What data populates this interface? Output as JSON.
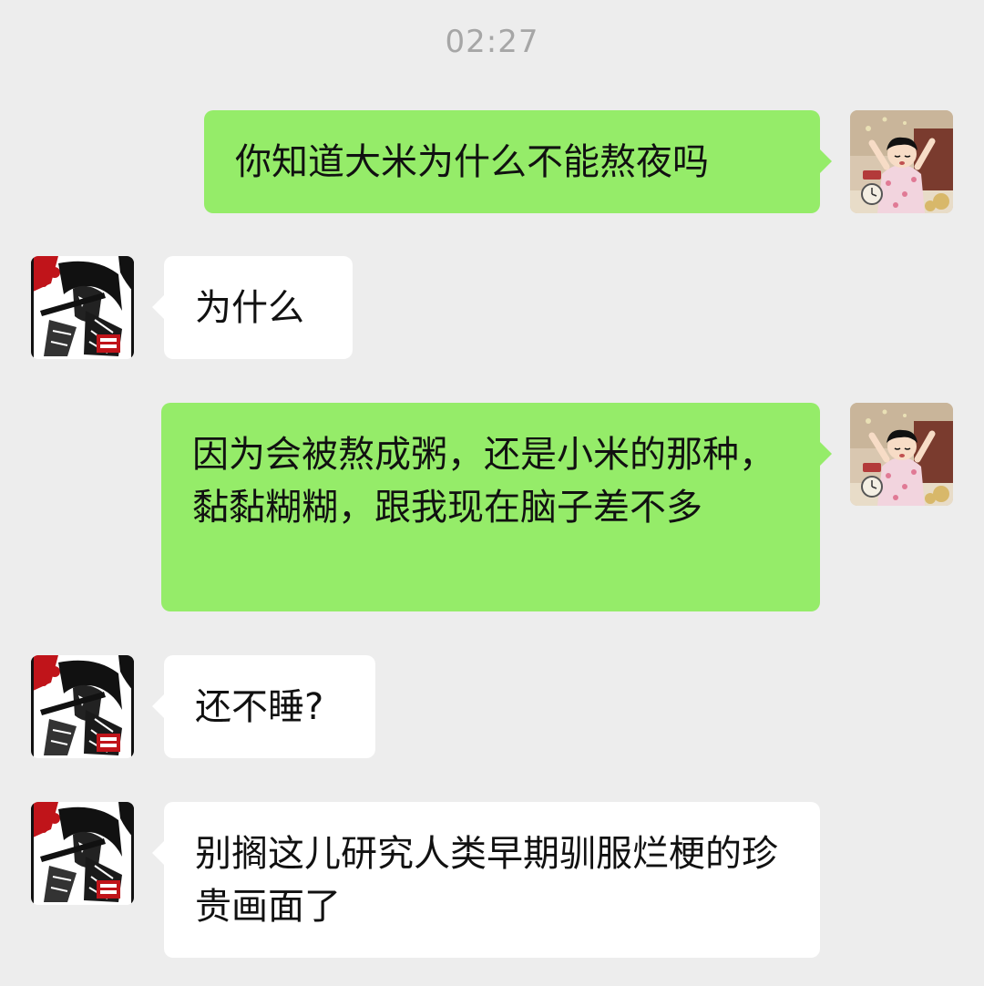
{
  "chat": {
    "timestamp": "02:27",
    "messages": [
      {
        "sender": "me",
        "text": "你知道大米为什么不能熬夜吗"
      },
      {
        "sender": "friend",
        "text": "为什么"
      },
      {
        "sender": "me",
        "text": "因为会被熬成粥，还是小米的那种，黏黏糊糊，跟我现在脑子差不多"
      },
      {
        "sender": "friend",
        "text": "还不睡?"
      },
      {
        "sender": "friend",
        "text": "别搁这儿研究人类早期驯服烂梗的珍贵画面了"
      }
    ]
  },
  "colors": {
    "background": "#ededed",
    "my_bubble": "#95ec69",
    "their_bubble": "#ffffff",
    "timestamp_text": "#a6a6a6"
  },
  "icons": {
    "my_avatar": "cartoon-kid-waking-up-avatar",
    "friend_avatar": "manga-ink-illustration-avatar"
  }
}
